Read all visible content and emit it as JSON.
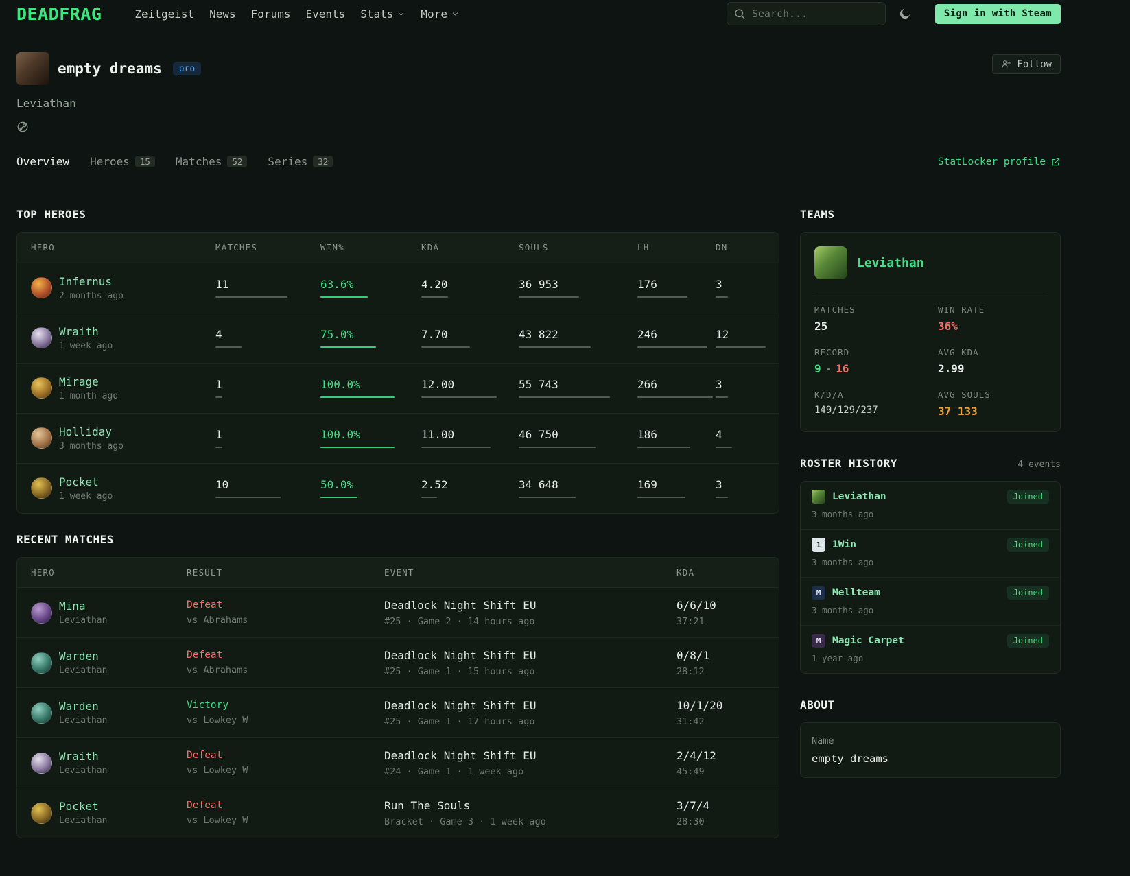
{
  "nav": {
    "brand": "DEADFRAG",
    "links": [
      {
        "label": "Zeitgeist"
      },
      {
        "label": "News"
      },
      {
        "label": "Forums"
      },
      {
        "label": "Events"
      },
      {
        "label": "Stats",
        "dropdown": true
      },
      {
        "label": "More",
        "dropdown": true
      }
    ],
    "search_placeholder": "Search...",
    "signin_label": "Sign in with Steam"
  },
  "profile": {
    "name": "empty dreams",
    "badge": "pro",
    "team": "Leviathan",
    "follow_label": "Follow"
  },
  "tabs": {
    "items": [
      {
        "label": "Overview",
        "active": true
      },
      {
        "label": "Heroes",
        "count": "15"
      },
      {
        "label": "Matches",
        "count": "52"
      },
      {
        "label": "Series",
        "count": "32"
      }
    ],
    "external_link": "StatLocker profile"
  },
  "top_heroes": {
    "title": "TOP HEROES",
    "columns": {
      "hero": "HERO",
      "matches": "MATCHES",
      "win": "WIN%",
      "kda": "KDA",
      "souls": "SOULS",
      "lh": "LH",
      "dn": "DN"
    },
    "rows": [
      {
        "hero": "Infernus",
        "hero_id": "infernus",
        "last_played": "2 months ago",
        "matches": "11",
        "win": "63.6%",
        "kda": "4.20",
        "souls": "36 953",
        "lh": "176",
        "dn": "3"
      },
      {
        "hero": "Wraith",
        "hero_id": "wraith",
        "last_played": "1 week ago",
        "matches": "4",
        "win": "75.0%",
        "kda": "7.70",
        "souls": "43 822",
        "lh": "246",
        "dn": "12"
      },
      {
        "hero": "Mirage",
        "hero_id": "mirage",
        "last_played": "1 month ago",
        "matches": "1",
        "win": "100.0%",
        "kda": "12.00",
        "souls": "55 743",
        "lh": "266",
        "dn": "3"
      },
      {
        "hero": "Holliday",
        "hero_id": "holliday",
        "last_played": "3 months ago",
        "matches": "1",
        "win": "100.0%",
        "kda": "11.00",
        "souls": "46 750",
        "lh": "186",
        "dn": "4"
      },
      {
        "hero": "Pocket",
        "hero_id": "pocket",
        "last_played": "1 week ago",
        "matches": "10",
        "win": "50.0%",
        "kda": "2.52",
        "souls": "34 648",
        "lh": "169",
        "dn": "3"
      }
    ]
  },
  "recent_matches": {
    "title": "RECENT MATCHES",
    "columns": {
      "hero": "HERO",
      "result": "RESULT",
      "event": "EVENT",
      "kda": "KDA"
    },
    "rows": [
      {
        "hero": "Mina",
        "hero_id": "mina",
        "team": "Leviathan",
        "result": "Defeat",
        "result_type": "defeat",
        "opponent": "vs Abrahams",
        "event": "Deadlock Night Shift EU",
        "event_details": "#25 · Game 2 · 14 hours ago",
        "kda": "6/6/10",
        "duration": "37:21"
      },
      {
        "hero": "Warden",
        "hero_id": "warden",
        "team": "Leviathan",
        "result": "Defeat",
        "result_type": "defeat",
        "opponent": "vs Abrahams",
        "event": "Deadlock Night Shift EU",
        "event_details": "#25 · Game 1 · 15 hours ago",
        "kda": "0/8/1",
        "duration": "28:12"
      },
      {
        "hero": "Warden",
        "hero_id": "warden",
        "team": "Leviathan",
        "result": "Victory",
        "result_type": "victory",
        "opponent": "vs Lowkey W",
        "event": "Deadlock Night Shift EU",
        "event_details": "#25 · Game 1 · 17 hours ago",
        "kda": "10/1/20",
        "duration": "31:42"
      },
      {
        "hero": "Wraith",
        "hero_id": "wraith",
        "team": "Leviathan",
        "result": "Defeat",
        "result_type": "defeat",
        "opponent": "vs Lowkey W",
        "event": "Deadlock Night Shift EU",
        "event_details": "#24 · Game 1 · 1 week ago",
        "kda": "2/4/12",
        "duration": "45:49"
      },
      {
        "hero": "Pocket",
        "hero_id": "pocket",
        "team": "Leviathan",
        "result": "Defeat",
        "result_type": "defeat",
        "opponent": "vs Lowkey W",
        "event": "Run The Souls",
        "event_details": "Bracket · Game 3 · 1 week ago",
        "kda": "3/7/4",
        "duration": "28:30"
      }
    ]
  },
  "teams": {
    "title": "TEAMS",
    "name": "Leviathan",
    "team_id": "leviathan",
    "matches_label": "MATCHES",
    "matches_value": "25",
    "winrate_label": "WIN RATE",
    "winrate_value": "36%",
    "record_label": "RECORD",
    "record_wins": "9",
    "record_sep": "-",
    "record_losses": "16",
    "avg_kda_label": "AVG KDA",
    "avg_kda_value": "2.99",
    "kda_label": "K/D/A",
    "kda_value": "149/129/237",
    "avg_souls_label": "AVG SOULS",
    "avg_souls_value": "37 133"
  },
  "roster_history": {
    "title": "ROSTER HISTORY",
    "events_count": "4 events",
    "items": [
      {
        "name": "Leviathan",
        "team_id": "leviathan",
        "icon_text": "",
        "badge": "Joined",
        "time": "3 months ago"
      },
      {
        "name": "1Win",
        "team_id": "1win",
        "icon_text": "1",
        "badge": "Joined",
        "time": "3 months ago"
      },
      {
        "name": "Mellteam",
        "team_id": "mellteam",
        "icon_text": "M",
        "badge": "Joined",
        "time": "3 months ago"
      },
      {
        "name": "Magic Carpet",
        "team_id": "magic-carpet",
        "icon_text": "M",
        "badge": "Joined",
        "time": "1 year ago"
      }
    ]
  },
  "about": {
    "title": "ABOUT",
    "name_label": "Name",
    "name_value": "empty dreams"
  },
  "colors": {
    "accent_green": "#41dd87",
    "hero_name_green": "#8fe6b4",
    "defeat_red": "#ef6f67",
    "victory_green": "#43db85",
    "souls_orange": "#e8a33b",
    "pro_badge_blue": "#5fa8f0",
    "signin_bg": "#7fe9ab"
  }
}
